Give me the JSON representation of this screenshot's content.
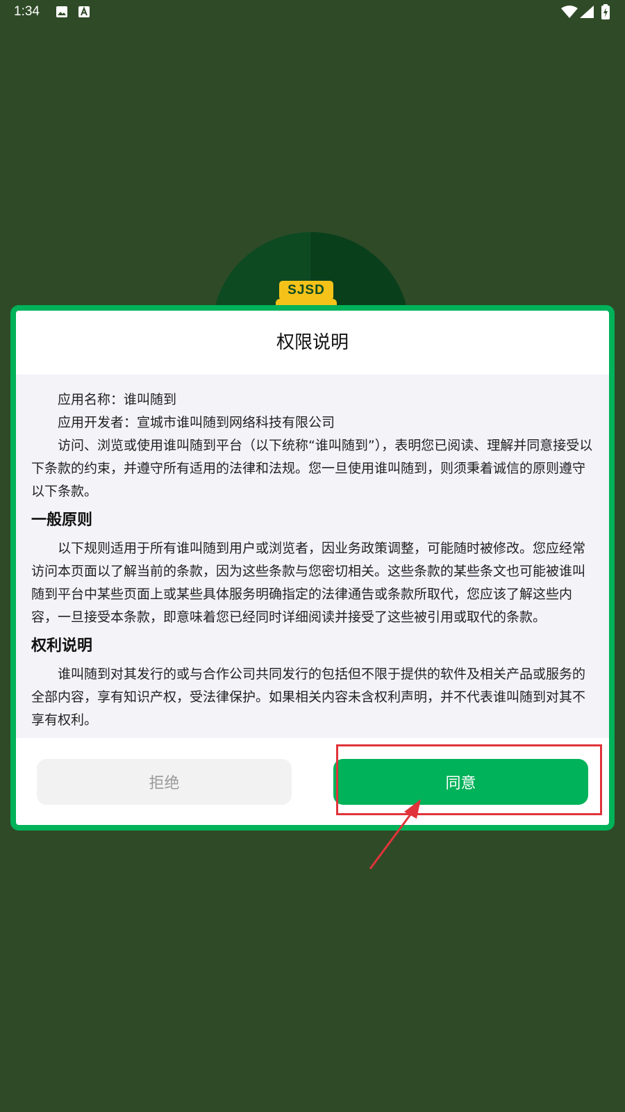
{
  "status_bar": {
    "time": "1:34",
    "icons": [
      "image-icon",
      "font-a-icon",
      "wifi-icon",
      "signal-icon",
      "battery-charging-icon"
    ]
  },
  "splash": {
    "logo_text": "SJSD"
  },
  "dialog": {
    "title": "权限说明",
    "paragraphs": {
      "app_name": "应用名称：谁叫随到",
      "developer": "应用开发者：宣城市谁叫随到网络科技有限公司",
      "intro": "访问、浏览或使用谁叫随到平台（以下统称“谁叫随到”），表明您已阅读、理解并同意接受以下条款的约束，并遵守所有适用的法律和法规。您一旦使用谁叫随到，则须秉着诚信的原则遵守以下条款。",
      "heading_general": "一般原则",
      "general": "以下规则适用于所有谁叫随到用户或浏览者，因业务政策调整，可能随时被修改。您应经常访问本页面以了解当前的条款，因为这些条款与您密切相关。这些条款的某些条文也可能被谁叫随到平台中某些页面上或某些具体服务明确指定的法律通告或条款所取代，您应该了解这些内容，一旦接受本条款，即意味着您已经同时详细阅读并接受了这些被引用或取代的条款。",
      "heading_rights": "权利说明",
      "rights": "谁叫随到对其发行的或与合作公司共同发行的包括但不限于提供的软件及相关产品或服务的全部内容，享有知识产权，受法律保护。如果相关内容未含权利声明，并不代表谁叫随到对其不享有权利。"
    },
    "reject_label": "拒绝",
    "agree_label": "同意"
  },
  "colors": {
    "background": "#2f4a27",
    "accent": "#00b259",
    "annotation": "#e0343a"
  }
}
